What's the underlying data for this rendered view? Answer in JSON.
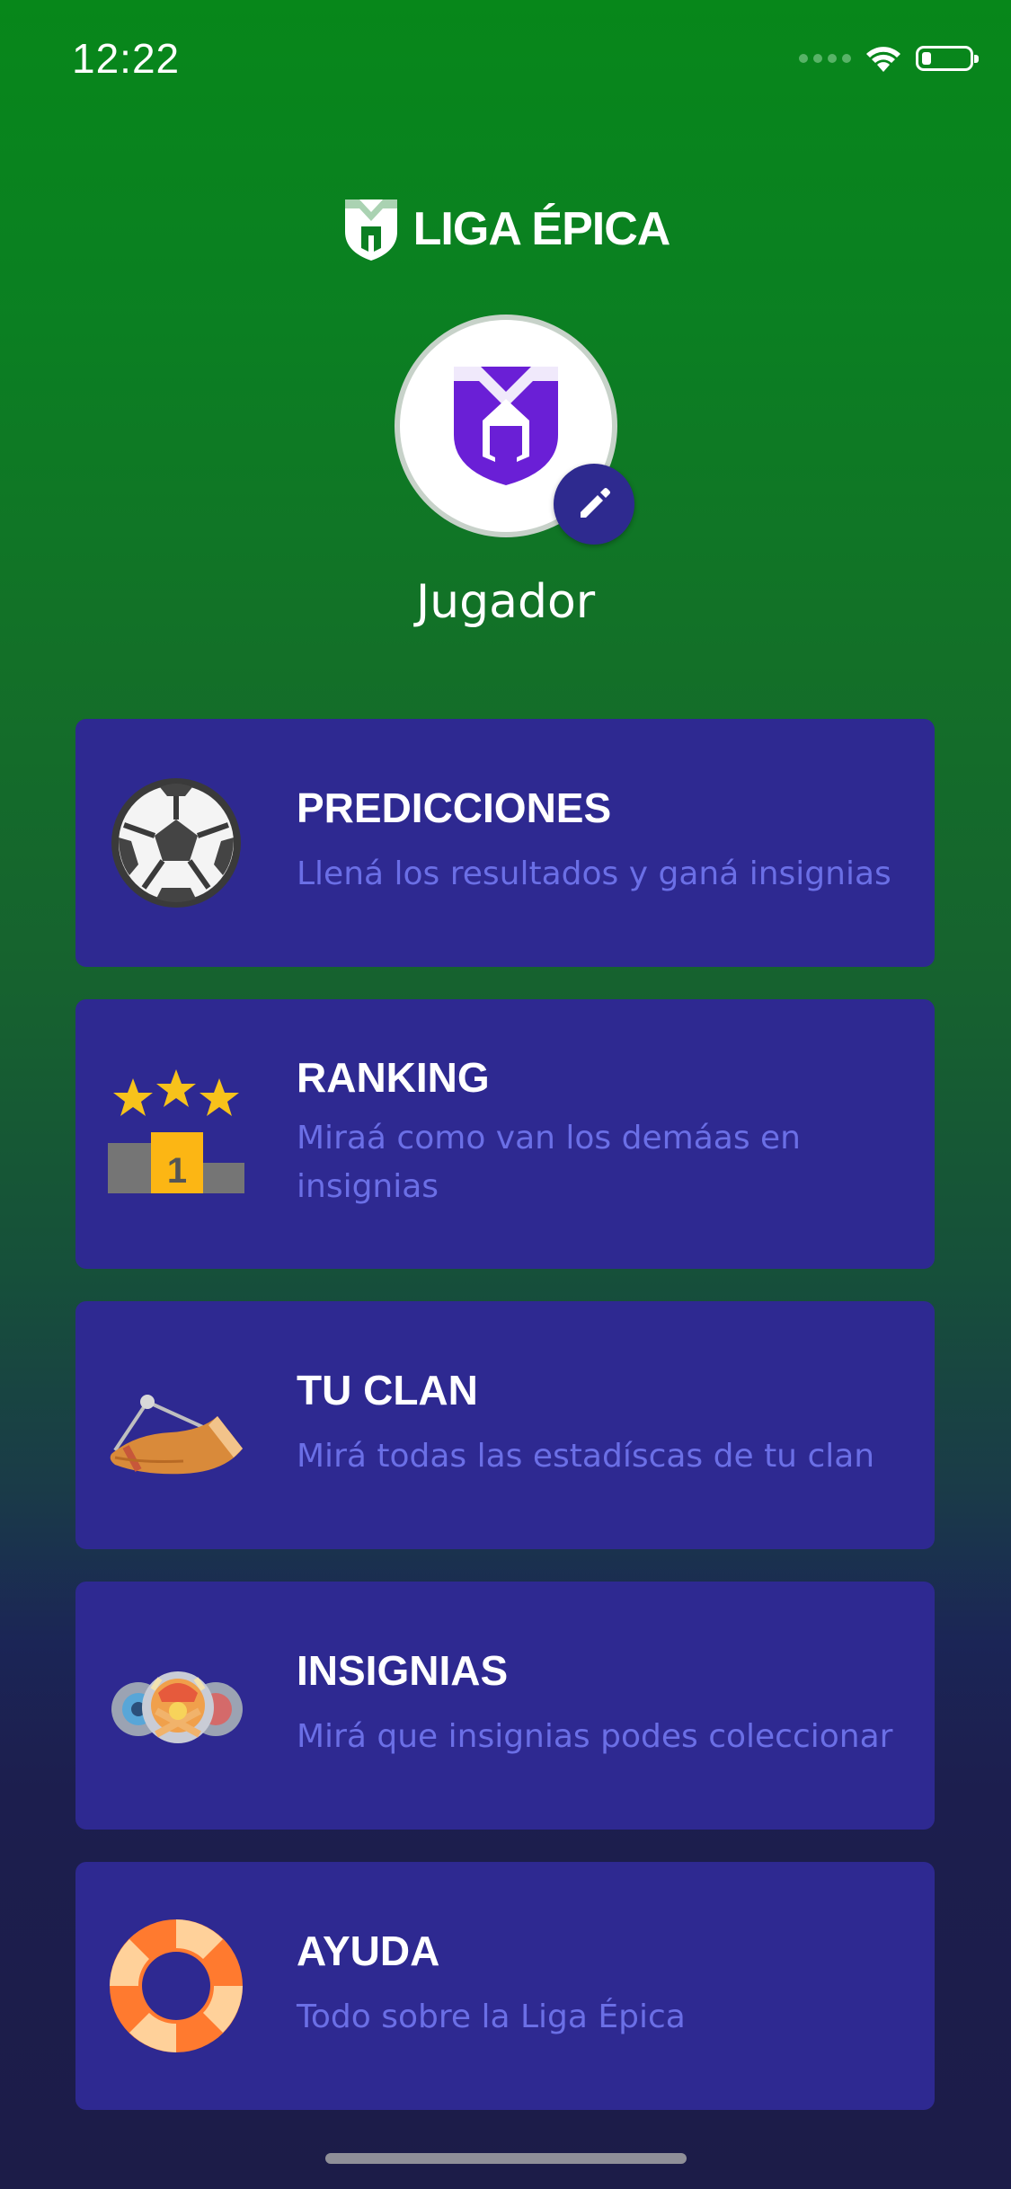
{
  "status_bar": {
    "time": "12:22"
  },
  "brand": {
    "name": "LIGA ÉPICA"
  },
  "profile": {
    "name": "Jugador"
  },
  "menu": [
    {
      "title": "PREDICCIONES",
      "description": "Llená los resultados y ganá insignias",
      "icon": "soccer-ball-icon"
    },
    {
      "title": "RANKING",
      "description": "Miraá como van los demáas en insignias",
      "icon": "podium-stars-icon"
    },
    {
      "title": "TU CLAN",
      "description": "Mirá todas las estadíscas de tu clan",
      "icon": "horn-icon"
    },
    {
      "title": "INSIGNIAS",
      "description": "Mirá que insignias podes coleccionar",
      "icon": "badges-icon"
    },
    {
      "title": "AYUDA",
      "description": "Todo sobre la Liga Épica",
      "icon": "lifebuoy-icon"
    }
  ],
  "colors": {
    "card": "#2e2991",
    "card_desc": "#6b6fe6",
    "accent_purple": "#6a1fd6",
    "green_top": "#07871a",
    "navy_bottom": "#1c1c48"
  }
}
